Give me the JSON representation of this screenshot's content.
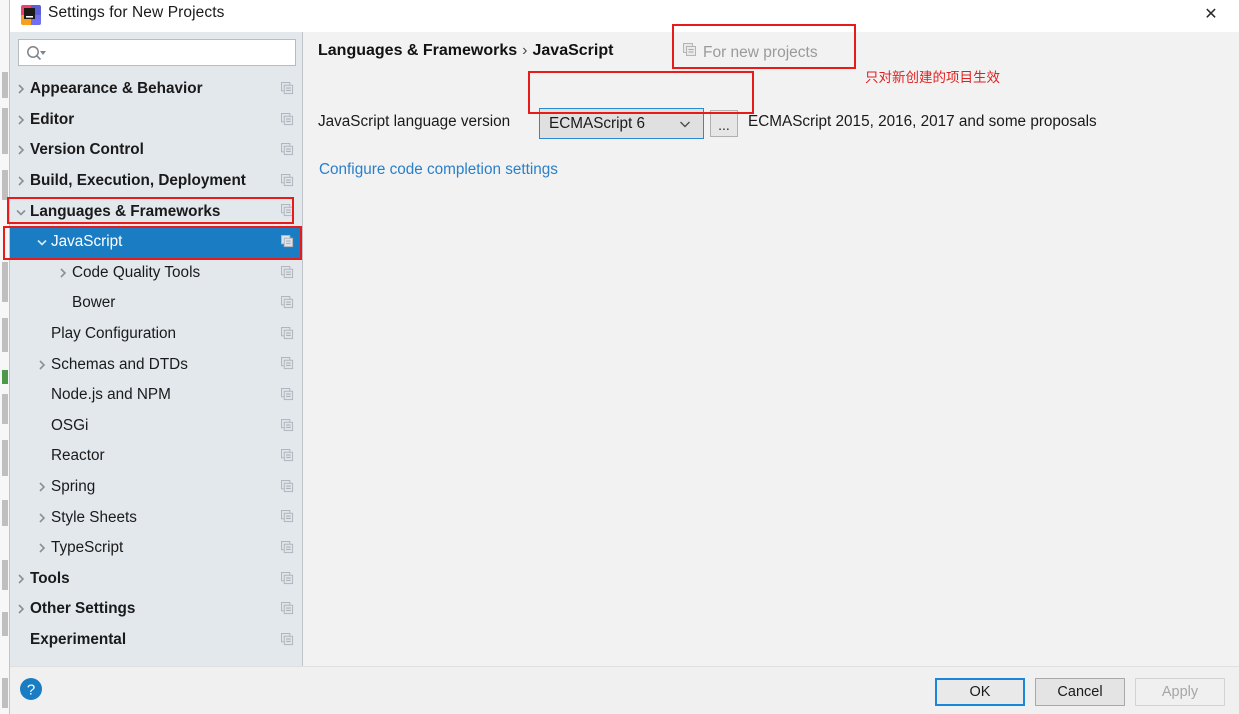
{
  "window": {
    "title": "Settings for New Projects",
    "logo_icon": "jetbrains-logo-icon",
    "close_icon": "close-icon",
    "close_label": "✕"
  },
  "sidebar": {
    "search": {
      "placeholder": "",
      "value": "",
      "icon": "search-icon"
    },
    "items": [
      {
        "label": "Appearance & Behavior",
        "indent": 20,
        "arrow": "right",
        "bold": true,
        "selected": false,
        "copy_icon": true
      },
      {
        "label": "Editor",
        "indent": 20,
        "arrow": "right",
        "bold": true,
        "selected": false,
        "copy_icon": true
      },
      {
        "label": "Version Control",
        "indent": 20,
        "arrow": "right",
        "bold": true,
        "selected": false,
        "copy_icon": true
      },
      {
        "label": "Build, Execution, Deployment",
        "indent": 20,
        "arrow": "right",
        "bold": true,
        "selected": false,
        "copy_icon": true
      },
      {
        "label": "Languages & Frameworks",
        "indent": 20,
        "arrow": "down",
        "bold": true,
        "selected": false,
        "copy_icon": true
      },
      {
        "label": "JavaScript",
        "indent": 41,
        "arrow": "down",
        "bold": false,
        "selected": true,
        "copy_icon": true
      },
      {
        "label": "Code Quality Tools",
        "indent": 62,
        "arrow": "right",
        "bold": false,
        "selected": false,
        "copy_icon": true
      },
      {
        "label": "Bower",
        "indent": 62,
        "arrow": "none",
        "bold": false,
        "selected": false,
        "copy_icon": true
      },
      {
        "label": "Play Configuration",
        "indent": 41,
        "arrow": "none",
        "bold": false,
        "selected": false,
        "copy_icon": true
      },
      {
        "label": "Schemas and DTDs",
        "indent": 41,
        "arrow": "right",
        "bold": false,
        "selected": false,
        "copy_icon": true
      },
      {
        "label": "Node.js and NPM",
        "indent": 41,
        "arrow": "none",
        "bold": false,
        "selected": false,
        "copy_icon": true
      },
      {
        "label": "OSGi",
        "indent": 41,
        "arrow": "none",
        "bold": false,
        "selected": false,
        "copy_icon": true
      },
      {
        "label": "Reactor",
        "indent": 41,
        "arrow": "none",
        "bold": false,
        "selected": false,
        "copy_icon": true
      },
      {
        "label": "Spring",
        "indent": 41,
        "arrow": "right",
        "bold": false,
        "selected": false,
        "copy_icon": true
      },
      {
        "label": "Style Sheets",
        "indent": 41,
        "arrow": "right",
        "bold": false,
        "selected": false,
        "copy_icon": true
      },
      {
        "label": "TypeScript",
        "indent": 41,
        "arrow": "right",
        "bold": false,
        "selected": false,
        "copy_icon": true
      },
      {
        "label": "Tools",
        "indent": 20,
        "arrow": "right",
        "bold": true,
        "selected": false,
        "copy_icon": true
      },
      {
        "label": "Other Settings",
        "indent": 20,
        "arrow": "right",
        "bold": true,
        "selected": false,
        "copy_icon": true
      },
      {
        "label": "Experimental",
        "indent": 20,
        "arrow": "none",
        "bold": true,
        "selected": false,
        "copy_icon": true
      }
    ]
  },
  "main": {
    "breadcrumb_root": "Languages & Frameworks",
    "breadcrumb_sep": "›",
    "breadcrumb_leaf": "JavaScript",
    "for_new_projects": "For new projects",
    "for_new_projects_icon": "copy-to-projects-icon",
    "annotation_cn": "只对新创建的项目生效",
    "field_label": "JavaScript language version",
    "combo_value": "ECMAScript 6",
    "combo_arrow_icon": "chevron-down-icon",
    "ellipsis_button": "...",
    "version_hint": "ECMAScript 2015, 2016, 2017 and some proposals",
    "link_text": "Configure code completion settings"
  },
  "footer": {
    "help_icon": "help-icon",
    "help_label": "?",
    "ok": "OK",
    "cancel": "Cancel",
    "apply": "Apply"
  },
  "colors": {
    "accent_blue": "#1a7dc4",
    "annotation_red": "#e81b1b",
    "sidebar_bg": "#e3e8ed",
    "content_bg": "#f2f2f2",
    "link_blue": "#2a7fc9"
  }
}
